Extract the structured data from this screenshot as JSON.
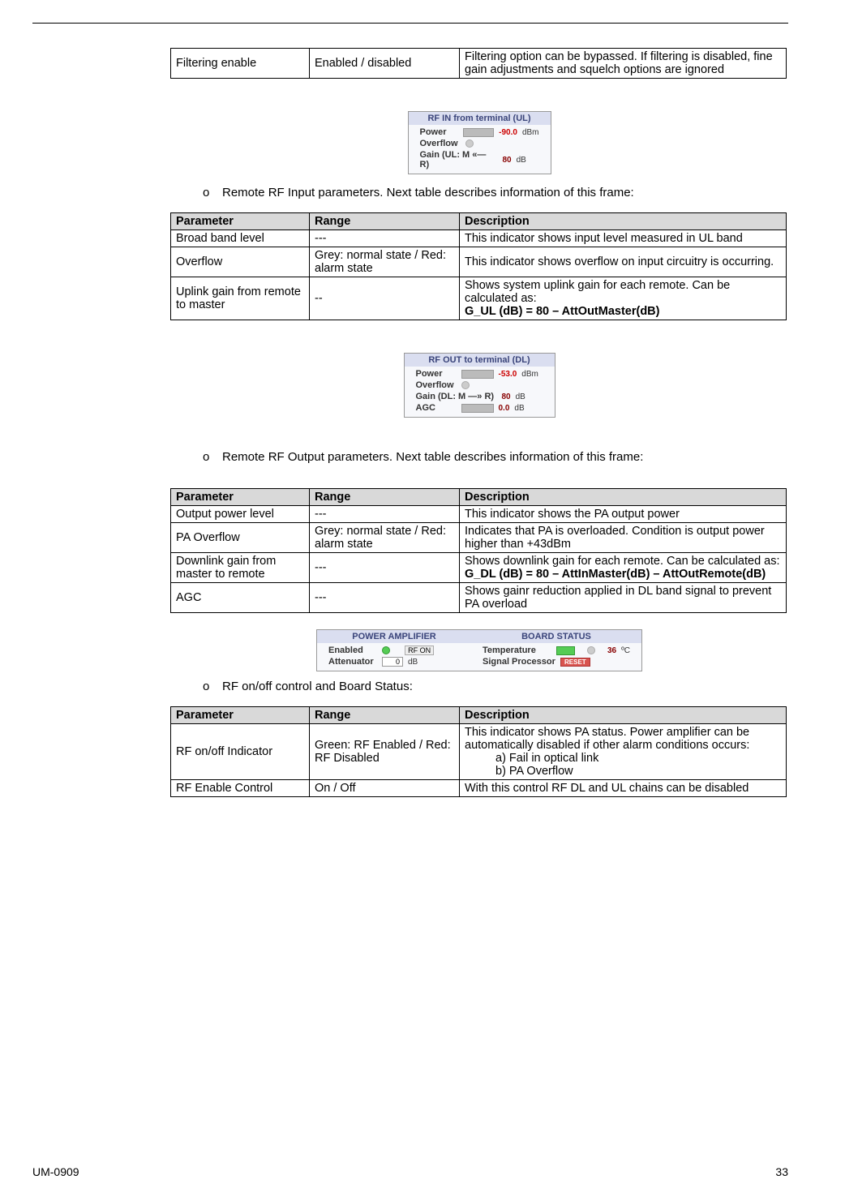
{
  "footer": {
    "doc": "UM-0909",
    "page": "33"
  },
  "filteringRow": {
    "param": "Filtering enable",
    "range": "Enabled / disabled",
    "desc": "Filtering option can be bypassed. If filtering is disabled, fine gain adjustments and squelch options are ignored"
  },
  "snippet1": {
    "title": "RF IN from terminal (UL)",
    "power_label": "Power",
    "power_val": "-90.0",
    "power_unit": "dBm",
    "overflow_label": "Overflow",
    "gain_label": "Gain (UL: M «— R)",
    "gain_val": "80",
    "gain_unit": "dB"
  },
  "bullet1": "Remote RF Input parameters. Next table describes information of this frame:",
  "table1": {
    "h1": "Parameter",
    "h2": "Range",
    "h3": "Description",
    "rows": [
      {
        "p": "Broad band level",
        "r": "---",
        "d": "This indicator shows input level measured in UL band"
      },
      {
        "p": "Overflow",
        "r": "Grey: normal state / Red: alarm state",
        "d": "This indicator shows overflow on input circuitry is occurring."
      },
      {
        "p": "Uplink gain from remote to master",
        "r": "--",
        "d": "Shows system uplink gain for each remote. Can be calculated as:\nG_UL (dB) = 80 – AttOutMaster(dB)",
        "bold": "G_UL (dB) = 80 – AttOutMaster(dB)"
      }
    ]
  },
  "snippet2": {
    "title": "RF OUT to terminal (DL)",
    "power_label": "Power",
    "power_val": "-53.0",
    "power_unit": "dBm",
    "overflow_label": "Overflow",
    "gain_label": "Gain (DL: M —» R)",
    "gain_val": "80",
    "gain_unit": "dB",
    "agc_label": "AGC",
    "agc_val": "0.0",
    "agc_unit": "dB"
  },
  "bullet2": "Remote RF Output parameters. Next table describes information of this frame:",
  "table2": {
    "h1": "Parameter",
    "h2": "Range",
    "h3": "Description",
    "rows": [
      {
        "p": "Output power level",
        "r": "---",
        "d": "This indicator shows the PA output power"
      },
      {
        "p": " PA Overflow",
        "r": "Grey: normal state / Red: alarm state",
        "d": "Indicates that PA is overloaded. Condition is output power higher than +43dBm"
      },
      {
        "p": "Downlink gain from master to remote",
        "r": "---",
        "d": "Shows downlink gain for each remote. Can be calculated as:\nG_DL (dB) = 80 – AttInMaster(dB) – AttOutRemote(dB)",
        "bold": "G_DL (dB) = 80 – AttInMaster(dB) – AttOutRemote(dB)"
      },
      {
        "p": "AGC",
        "r": "---",
        "d": "Shows gainr reduction applied in DL band signal to prevent PA overload"
      }
    ]
  },
  "snippet3": {
    "pa_title": "POWER AMPLIFIER",
    "enabled_label": "Enabled",
    "rf_on": "RF ON",
    "att_label": "Attenuator",
    "att_val": "0",
    "att_unit": "dB",
    "bs_title": "BOARD STATUS",
    "temp_label": "Temperature",
    "temp_val": "36",
    "temp_unit": "ºC",
    "sp_label": "Signal Processor",
    "reset": "RESET"
  },
  "bullet3": "RF on/off control and Board Status:",
  "table3": {
    "h1": "Parameter",
    "h2": "Range",
    "h3": "Description",
    "rows": [
      {
        "p": "RF on/off Indicator",
        "r": "Green: RF Enabled / Red: RF Disabled",
        "d_intro": "This indicator shows PA status. Power amplifier can be automatically disabled if other alarm conditions occurs:",
        "d_a": "a)    Fail in optical link",
        "d_b": "b)    PA Overflow"
      },
      {
        "p": "RF Enable Control",
        "r": "On / Off",
        "d": "With this control RF DL and UL chains can be disabled"
      }
    ]
  }
}
